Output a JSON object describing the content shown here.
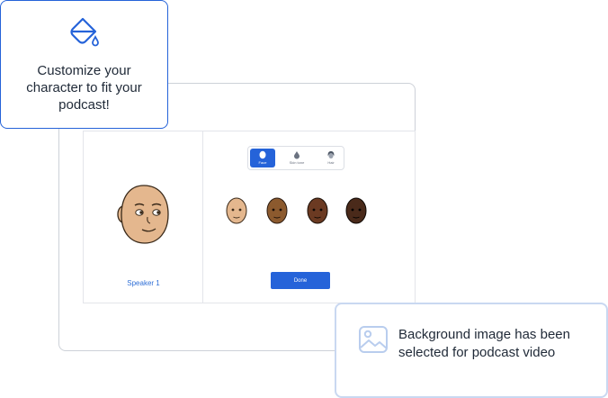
{
  "callouts": {
    "customize": {
      "icon": "paint-bucket-icon",
      "text": "Customize your character to fit your podcast!"
    },
    "background": {
      "icon": "image-icon",
      "text": "Background image has been selected for podcast video"
    }
  },
  "editor": {
    "speaker_label": "Speaker 1",
    "tabs": [
      {
        "label": "Face",
        "icon": "face-icon",
        "active": true
      },
      {
        "label": "Skin tone",
        "icon": "droplet-icon",
        "active": false
      },
      {
        "label": "Hair",
        "icon": "hair-icon",
        "active": false
      }
    ],
    "skin_tones": [
      "#e4b78e",
      "#8c5a2e",
      "#6b3a22",
      "#4a2a1a"
    ],
    "done_label": "Done"
  },
  "colors": {
    "accent": "#2563d9",
    "speaker_label": "#2f6fd6",
    "bottom_callout_border": "#c9d8f1"
  }
}
